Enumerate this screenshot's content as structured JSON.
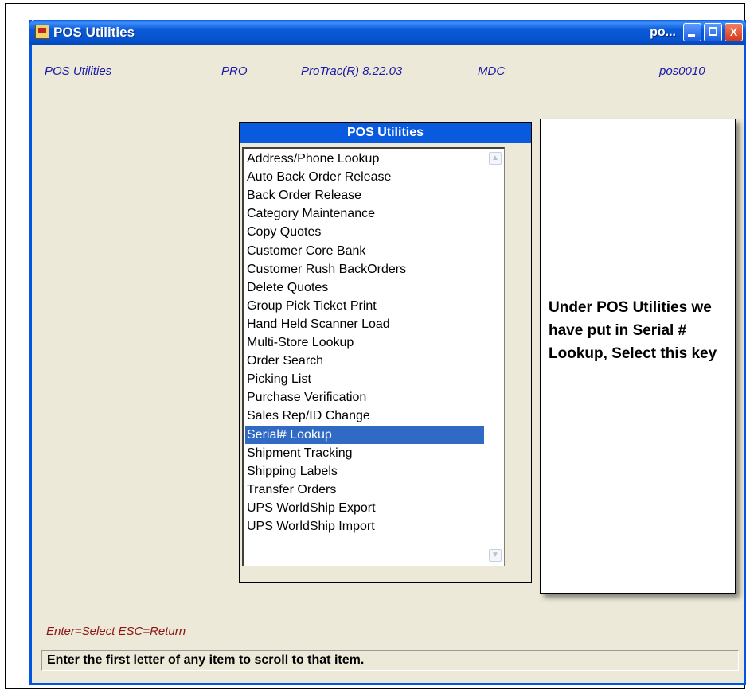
{
  "window": {
    "title": "POS Utilities",
    "title_truncated": "po...",
    "min_label": "",
    "max_label": "",
    "close_label": "X"
  },
  "info": {
    "module": "POS Utilities",
    "edition": "PRO",
    "version": "ProTrac(R) 8.22.03",
    "company": "MDC",
    "program": "pos0010"
  },
  "panel": {
    "title": "POS Utilities",
    "items": [
      "Address/Phone Lookup",
      "Auto Back Order Release",
      "Back Order Release",
      "Category Maintenance",
      "Copy Quotes",
      "Customer Core Bank",
      "Customer Rush BackOrders",
      "Delete Quotes",
      "Group Pick Ticket Print",
      "Hand Held Scanner Load",
      "Multi-Store Lookup",
      "Order Search",
      "Picking List",
      "Purchase Verification",
      "Sales Rep/ID Change",
      "Serial# Lookup",
      "Shipment Tracking",
      "Shipping Labels",
      "Transfer Orders",
      "UPS WorldShip Export",
      "UPS WorldShip Import"
    ],
    "selected": "Serial# Lookup"
  },
  "callout": {
    "text": "Under POS Utilities we have put in Serial # Lookup, Select this key"
  },
  "hint": "Enter=Select  ESC=Return",
  "status": "Enter the first letter of any item to scroll to that item.",
  "colors": {
    "titlebar": "#0a5ae0",
    "selection": "#316ac5",
    "info_text": "#1a1aa8",
    "hint_text": "#8b1414",
    "window_bg": "#ece9d8"
  },
  "icons": {
    "app": "app-icon",
    "minimize": "minimize-icon",
    "maximize": "maximize-icon",
    "close": "close-icon",
    "scroll_up": "chevron-up-icon",
    "scroll_down": "chevron-down-icon"
  }
}
